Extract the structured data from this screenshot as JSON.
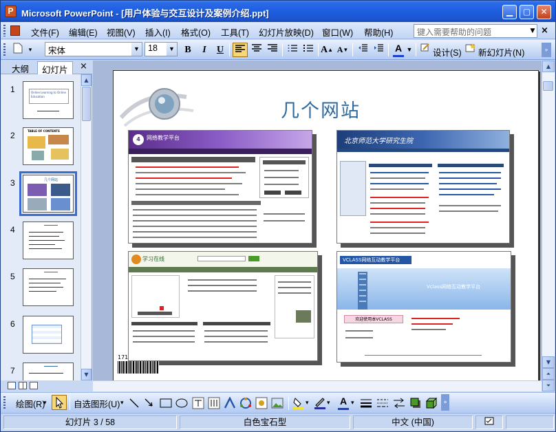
{
  "window": {
    "title": "Microsoft PowerPoint - [用户体验与交互设计及案例介绍.ppt]",
    "icon": "P"
  },
  "menu": {
    "items": [
      "文件(F)",
      "编辑(E)",
      "视图(V)",
      "插入(I)",
      "格式(O)",
      "工具(T)",
      "幻灯片放映(D)",
      "窗口(W)",
      "帮助(H)"
    ],
    "help_placeholder": "键入需要帮助的问题"
  },
  "toolbar": {
    "font_name": "宋体",
    "font_size": "18",
    "bold": "B",
    "italic": "I",
    "underline": "U",
    "design_label": "设计(S)",
    "new_slide_label": "新幻灯片(N)",
    "font_color_label": "A"
  },
  "pane": {
    "tab_outline": "大纲",
    "tab_slides": "幻灯片",
    "close": "×",
    "thumbnails": [
      {
        "num": "1",
        "caption": "Online Learning to Online Education"
      },
      {
        "num": "2",
        "caption": "TABLE OF CONTENTS"
      },
      {
        "num": "3",
        "caption": "几个网站",
        "selected": true
      },
      {
        "num": "4",
        "caption": ""
      },
      {
        "num": "5",
        "caption": ""
      },
      {
        "num": "6",
        "caption": ""
      },
      {
        "num": "7",
        "caption": ""
      }
    ]
  },
  "slide": {
    "title": "几个网站",
    "shot1_header": "网络教学平台",
    "shot2_header": "北京师范大学研究生院",
    "shot3_header": "学习在线",
    "shot4_header": "VCLASS网络互动教学平台",
    "shot4_banner": "Vclass网络互动教学平台",
    "shot4_welcome": "欢迎使用本VCLASS",
    "barcode_text": "171"
  },
  "drawing": {
    "draw_label": "绘图(R)",
    "autoshapes_label": "自选图形(U)"
  },
  "status": {
    "slide_info": "幻灯片 3 / 58",
    "design": "白色宝石型",
    "language": "中文 (中国)"
  },
  "colors": {
    "titlebar": "#1e5ee0",
    "slide_title": "#2f6aa0",
    "selection": "#3a6ad0"
  }
}
